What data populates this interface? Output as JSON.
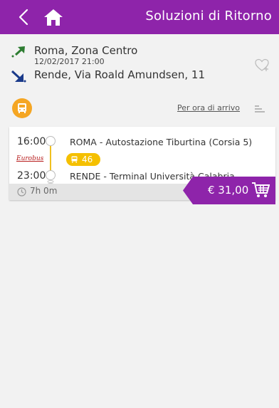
{
  "header": {
    "title": "Soluzioni di Ritorno"
  },
  "route": {
    "from": {
      "place": "Roma, Zona Centro",
      "datetime": "12/02/2017 21:00"
    },
    "to": {
      "place": "Rende, Via Roald Amundsen, 11"
    }
  },
  "filters": {
    "sort_label": "Per ora di arrivo"
  },
  "solutions": [
    {
      "departure_time": "16:00",
      "departure_station": "ROMA - Autostazione Tiburtina (Corsia 5)",
      "arrival_time": "23:00",
      "arrival_station": "RENDE - Terminal Università Calabria",
      "operator": "Eurobus",
      "seats_badge": "46",
      "duration": "7h 0m",
      "price": "€ 31,00"
    }
  ],
  "colors": {
    "brand": "#8e24aa",
    "accent": "#f5a623",
    "badge": "#f5c000"
  }
}
